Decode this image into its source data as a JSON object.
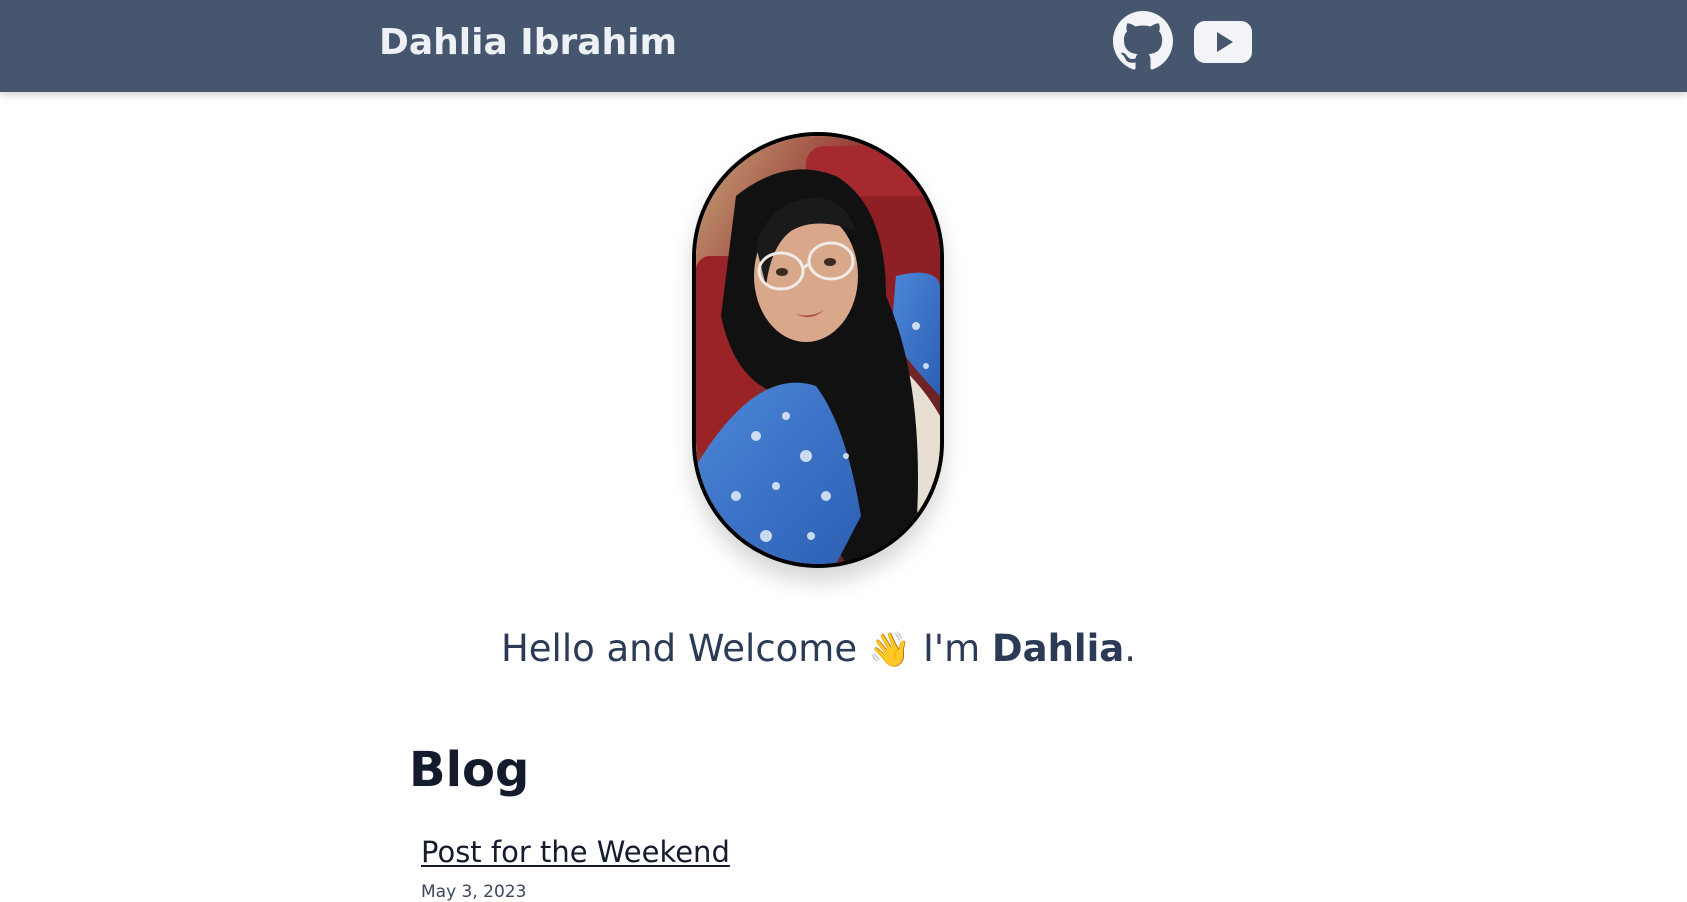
{
  "header": {
    "site_title": "Dahlia Ibrahim",
    "links": [
      {
        "name": "github",
        "icon": "github-icon"
      },
      {
        "name": "youtube",
        "icon": "youtube-icon"
      }
    ],
    "background_color": "#46566e"
  },
  "profile": {
    "photo_alt": "Dahlia portrait photo"
  },
  "greeting": {
    "prefix": "Hello and Welcome",
    "wave_emoji": "👋",
    "im": "I'm",
    "name": "Dahlia",
    "suffix": "."
  },
  "blog": {
    "heading": "Blog",
    "posts": [
      {
        "title": "Post for the Weekend",
        "date": "May 3, 2023"
      }
    ]
  }
}
